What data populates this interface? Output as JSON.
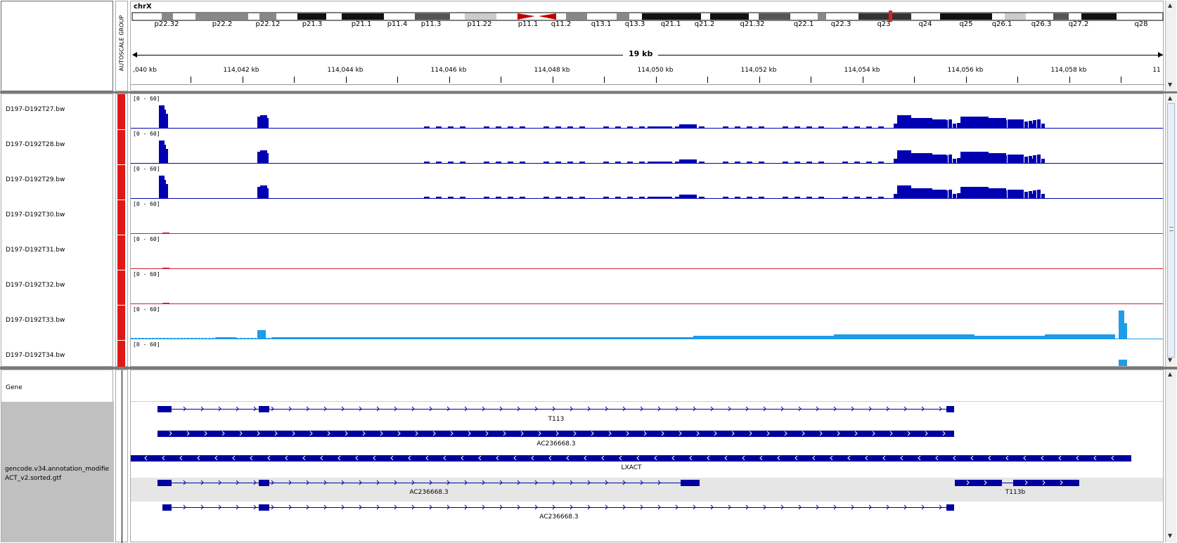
{
  "header": {
    "chromosome": "chrX",
    "autoscale_label": "AUTOSCALE GROUP",
    "span_label": "19 kb"
  },
  "cytobands": [
    {
      "name": "p22.32",
      "pos": 236
    },
    {
      "name": "p22.2",
      "pos": 315
    },
    {
      "name": "p22.12",
      "pos": 380
    },
    {
      "name": "p21.3",
      "pos": 443
    },
    {
      "name": "p21.1",
      "pos": 513
    },
    {
      "name": "p11.4",
      "pos": 564
    },
    {
      "name": "p11.3",
      "pos": 612
    },
    {
      "name": "p11.22",
      "pos": 681
    },
    {
      "name": "p11.1",
      "pos": 750
    },
    {
      "name": "q11.2",
      "pos": 797
    },
    {
      "name": "q13.1",
      "pos": 854
    },
    {
      "name": "q13.3",
      "pos": 902
    },
    {
      "name": "q21.1",
      "pos": 953
    },
    {
      "name": "q21.2",
      "pos": 1001
    },
    {
      "name": "q21.32",
      "pos": 1069
    },
    {
      "name": "q22.1",
      "pos": 1142
    },
    {
      "name": "q22.3",
      "pos": 1195
    },
    {
      "name": "q23",
      "pos": 1256
    },
    {
      "name": "q24",
      "pos": 1315
    },
    {
      "name": "q25",
      "pos": 1373
    },
    {
      "name": "q26.1",
      "pos": 1424
    },
    {
      "name": "q26.3",
      "pos": 1480
    },
    {
      "name": "q27.2",
      "pos": 1533
    },
    {
      "name": "q28",
      "pos": 1622
    }
  ],
  "ruler": {
    "ticks": [
      {
        "label": ",040 kb",
        "pos": 205
      },
      {
        "label": "114,042 kb",
        "pos": 342
      },
      {
        "label": "114,044 kb",
        "pos": 490
      },
      {
        "label": "114,046 kb",
        "pos": 637
      },
      {
        "label": "114,048 kb",
        "pos": 784
      },
      {
        "label": "114,050 kb",
        "pos": 931
      },
      {
        "label": "114,052 kb",
        "pos": 1078
      },
      {
        "label": "114,054 kb",
        "pos": 1225
      },
      {
        "label": "114,056 kb",
        "pos": 1372
      },
      {
        "label": "114,058 kb",
        "pos": 1519
      },
      {
        "label": "11",
        "pos": 1644
      }
    ]
  },
  "tracks": [
    {
      "name": "D197-D192T27.bw",
      "range": "[0 - 60]",
      "color": "#0000b2",
      "empty": false
    },
    {
      "name": "D197-D192T28.bw",
      "range": "[0 - 60]",
      "color": "#0000b2",
      "empty": false
    },
    {
      "name": "D197-D192T29.bw",
      "range": "[0 - 60]",
      "color": "#0000b2",
      "empty": false
    },
    {
      "name": "D197-D192T30.bw",
      "range": "[0 - 60]",
      "color": "#d21e3c",
      "empty": true
    },
    {
      "name": "D197-D192T31.bw",
      "range": "[0 - 60]",
      "color": "#d21e3c",
      "empty": true
    },
    {
      "name": "D197-D192T32.bw",
      "range": "[0 - 60]",
      "color": "#d21e3c",
      "empty": true
    },
    {
      "name": "D197-D192T33.bw",
      "range": "[0 - 60]",
      "color": "#1f9bea",
      "empty": false
    },
    {
      "name": "D197-D192T34.bw",
      "range": "[0 - 60]",
      "color": "#1f9bea",
      "empty": false
    }
  ],
  "gene_panel": {
    "gene_track": "Gene",
    "annotation_track_line1": "gencode.v34.annotation_modifie",
    "annotation_track_line2": "ACT_v2.sorted.gtf"
  },
  "transcripts": [
    {
      "label": "T113"
    },
    {
      "label": "AC236668.3"
    },
    {
      "label": "LXACT"
    },
    {
      "label": "AC236668.3"
    },
    {
      "label": "T113b"
    },
    {
      "label": "AC236668.3"
    }
  ],
  "colors": {
    "accent_red": "#e02020",
    "gene_blue": "#0000a0",
    "panel_gray": "#c0c0c0"
  }
}
